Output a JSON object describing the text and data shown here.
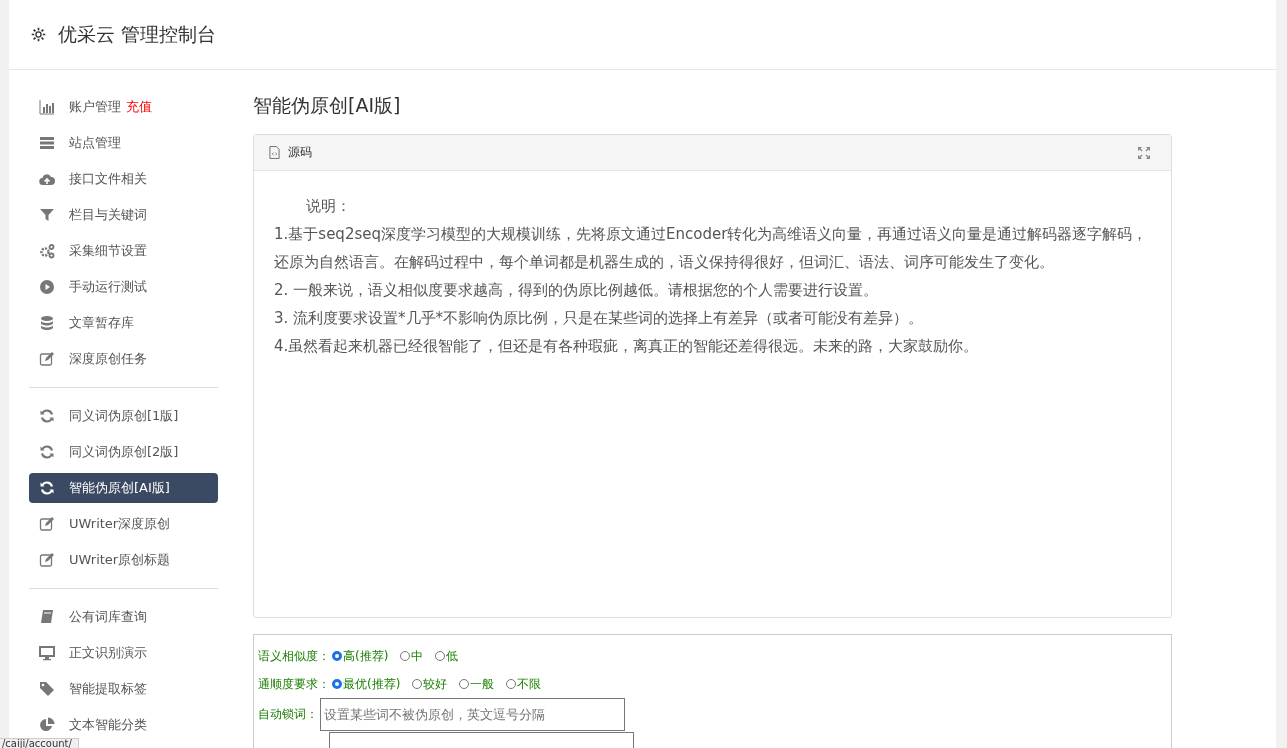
{
  "header": {
    "title": "优采云 管理控制台"
  },
  "sidebar": {
    "groups": [
      [
        {
          "label": "账户管理",
          "badge": "充值",
          "selected": false
        },
        {
          "label": "站点管理",
          "selected": false
        },
        {
          "label": "接口文件相关",
          "selected": false
        },
        {
          "label": "栏目与关键词",
          "selected": false
        },
        {
          "label": "采集细节设置",
          "selected": false
        },
        {
          "label": "手动运行测试",
          "selected": false
        },
        {
          "label": "文章暂存库",
          "selected": false
        },
        {
          "label": "深度原创任务",
          "selected": false
        }
      ],
      [
        {
          "label": "同义词伪原创[1版]",
          "selected": false
        },
        {
          "label": "同义词伪原创[2版]",
          "selected": false
        },
        {
          "label": "智能伪原创[AI版]",
          "selected": true
        },
        {
          "label": "UWriter深度原创",
          "selected": false
        },
        {
          "label": "UWriter原创标题",
          "selected": false
        }
      ],
      [
        {
          "label": "公有词库查询",
          "selected": false
        },
        {
          "label": "正文识别演示",
          "selected": false
        },
        {
          "label": "智能提取标签",
          "selected": false
        },
        {
          "label": "文本智能分类",
          "selected": false
        }
      ]
    ]
  },
  "page_title": "智能伪原创[AI版]",
  "source_panel": {
    "title": "源码",
    "heading": "说明：",
    "paragraphs": [
      "1.基于seq2seq深度学习模型的大规模训练，先将原文通过Encoder转化为高维语义向量，再通过语义向量是通过解码器逐字解码，还原为自然语言。在解码过程中，每个单词都是机器生成的，语义保持得很好，但词汇、语法、词序可能发生了变化。",
      "2. 一般来说，语义相似度要求越高，得到的伪原比例越低。请根据您的个人需要进行设置。",
      "3. 流利度要求设置*几乎*不影响伪原比例，只是在某些词的选择上有差异（或者可能没有差异）。",
      "4.虽然看起来机器已经很智能了，但还是有各种瑕疵，离真正的智能还差得很远。未来的路，大家鼓励你。"
    ]
  },
  "form": {
    "rows": [
      {
        "kind": "radio",
        "label": "语义相似度：",
        "options": [
          {
            "label": "高(推荐)",
            "selected": true
          },
          {
            "label": "中",
            "selected": false
          },
          {
            "label": "低",
            "selected": false
          }
        ]
      },
      {
        "kind": "radio",
        "label": "通顺度要求：",
        "options": [
          {
            "label": "最优(推荐)",
            "selected": true
          },
          {
            "label": "较好",
            "selected": false
          },
          {
            "label": "一般",
            "selected": false
          },
          {
            "label": "不限",
            "selected": false
          }
        ]
      },
      {
        "kind": "text",
        "label": "自动锁词：",
        "placeholder": "设置某些词不被伪原创，英文逗号分隔"
      }
    ]
  },
  "status_url": "/caiji/account/"
}
